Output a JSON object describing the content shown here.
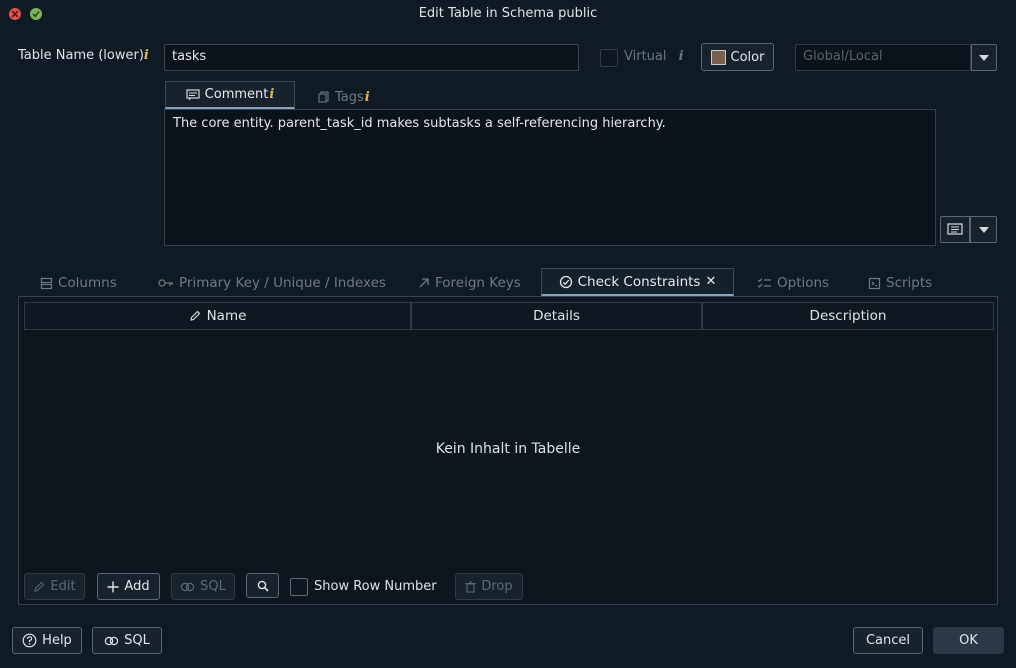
{
  "window": {
    "title": "Edit Table in Schema public"
  },
  "table_name": {
    "label": "Table Name (lower)",
    "info": "i",
    "value": "tasks"
  },
  "virtual": {
    "label": "Virtual",
    "info": "i",
    "checked": false
  },
  "color_button": {
    "label": "Color",
    "swatch": "#7a5f4e"
  },
  "scope_select": {
    "value": "Global/Local"
  },
  "comment_tabs": [
    {
      "label": "Comment",
      "info": "i",
      "active": true
    },
    {
      "label": "Tags",
      "info": "i",
      "active": false
    }
  ],
  "comment": {
    "text": "The core entity. parent_task_id makes subtasks a self-referencing hierarchy."
  },
  "main_tabs": [
    {
      "label": "Columns",
      "icon": "columns-icon"
    },
    {
      "label": "Primary Key / Unique / Indexes",
      "icon": "key-icon"
    },
    {
      "label": "Foreign Keys",
      "icon": "arrow-up-right-icon"
    },
    {
      "label": "Check Constraints",
      "icon": "check-circle-icon",
      "active": true,
      "close": "✕"
    },
    {
      "label": "Options",
      "icon": "checklist-icon"
    },
    {
      "label": "Scripts",
      "icon": "script-icon"
    }
  ],
  "grid": {
    "columns": [
      "Name",
      "Details",
      "Description"
    ],
    "empty_text": "Kein Inhalt in Tabelle"
  },
  "toolbar": {
    "edit": "Edit",
    "add": "Add",
    "sql": "SQL",
    "show_row_number": "Show Row Number",
    "drop": "Drop"
  },
  "footer": {
    "help": "Help",
    "sql": "SQL",
    "cancel": "Cancel",
    "ok": "OK"
  }
}
